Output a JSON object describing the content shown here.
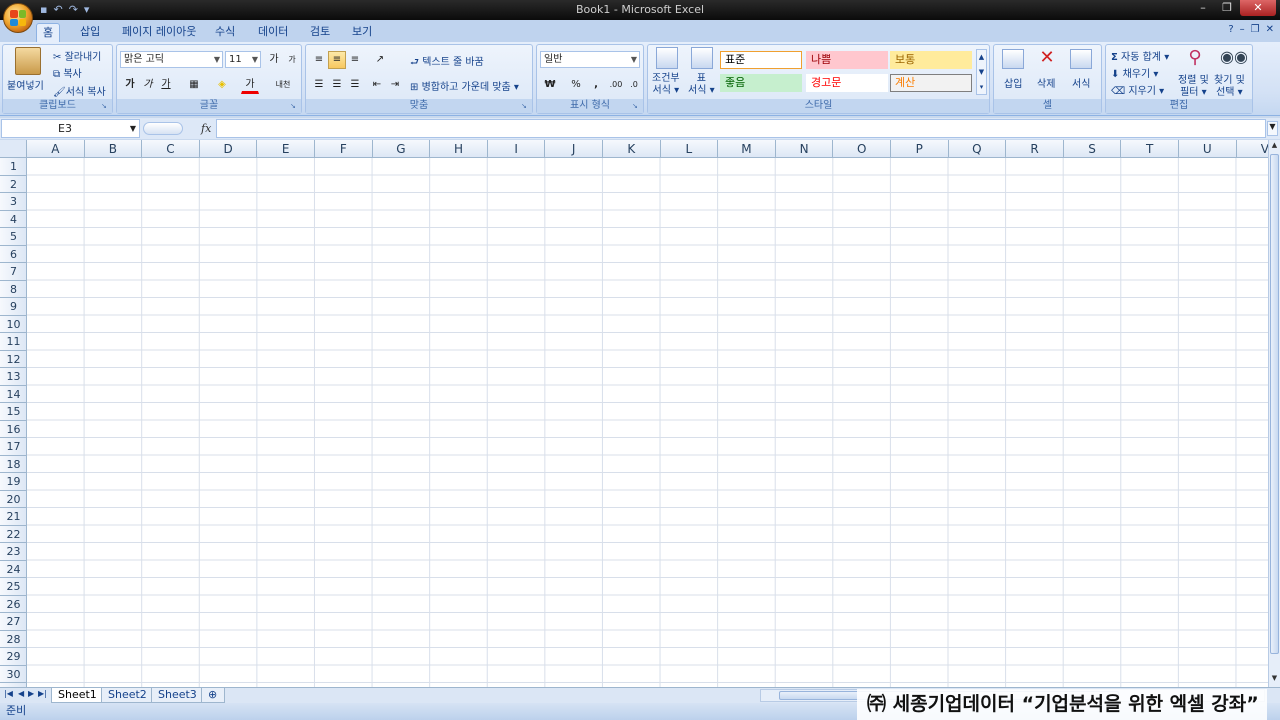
{
  "window": {
    "title": "Book1 - Microsoft Excel"
  },
  "ribbon_tabs": [
    "홈",
    "삽입",
    "페이지 레이아웃",
    "수식",
    "데이터",
    "검토",
    "보기"
  ],
  "clipboard": {
    "paste": "붙여넣기",
    "cut": "잘라내기",
    "copy": "복사",
    "format_painter": "서식 복사",
    "label": "클립보드"
  },
  "font": {
    "name": "맑은 고딕",
    "size": "11",
    "grow": "가",
    "shrink": "가",
    "bold": "가",
    "italic": "가",
    "underline": "가",
    "font_color": "가",
    "phonetic": "내천",
    "label": "글꼴"
  },
  "alignment": {
    "wrap_text": "텍스트 줄 바꿈",
    "merge_center": "병합하고 가운데 맞춤",
    "label": "맞춤"
  },
  "number": {
    "format": "일반",
    "currency": "₩",
    "percent": "%",
    "comma": ",",
    "label": "표시 형식"
  },
  "styles": {
    "conditional": [
      "조건부",
      "서식"
    ],
    "table": [
      "표",
      "서식"
    ],
    "cells": [
      {
        "label": "표준",
        "bg": "#ffffff",
        "fg": "#000000"
      },
      {
        "label": "나쁨",
        "bg": "#ffc7ce",
        "fg": "#9c0006"
      },
      {
        "label": "보통",
        "bg": "#ffeb9c",
        "fg": "#9c6500"
      },
      {
        "label": "좋음",
        "bg": "#c6efce",
        "fg": "#006100"
      },
      {
        "label": "경고문",
        "bg": "#ffffff",
        "fg": "#ff0000"
      },
      {
        "label": "계산",
        "bg": "#f2f2f2",
        "fg": "#fa7d00"
      }
    ],
    "label": "스타일"
  },
  "cells_group": {
    "insert": "삽입",
    "delete": "삭제",
    "format": "서식",
    "label": "셀"
  },
  "editing": {
    "autosum": "자동 합계",
    "fill": "채우기",
    "clear": "지우기",
    "sort_filter": [
      "정렬 및",
      "필터"
    ],
    "find_select": [
      "찾기 및",
      "선택"
    ],
    "label": "편집"
  },
  "formula_bar": {
    "name_box": "E3",
    "fx": "fx",
    "value": ""
  },
  "columns": [
    "A",
    "B",
    "C",
    "D",
    "E",
    "F",
    "G",
    "H",
    "I",
    "J",
    "K",
    "L",
    "M",
    "N",
    "O",
    "P",
    "Q",
    "R",
    "S",
    "T",
    "U",
    "V"
  ],
  "rows": [
    "1",
    "2",
    "3",
    "4",
    "5",
    "6",
    "7",
    "8",
    "9",
    "10",
    "11",
    "12",
    "13",
    "14",
    "15",
    "16",
    "17",
    "18",
    "19",
    "20",
    "21",
    "22",
    "23",
    "24",
    "25",
    "26",
    "27",
    "28",
    "29",
    "30"
  ],
  "sheets": [
    "Sheet1",
    "Sheet2",
    "Sheet3"
  ],
  "active_sheet": "Sheet1",
  "status": "준비",
  "watermark": "㈜ 세종기업데이터 “기업분석을 위한 엑셀 강좌”"
}
